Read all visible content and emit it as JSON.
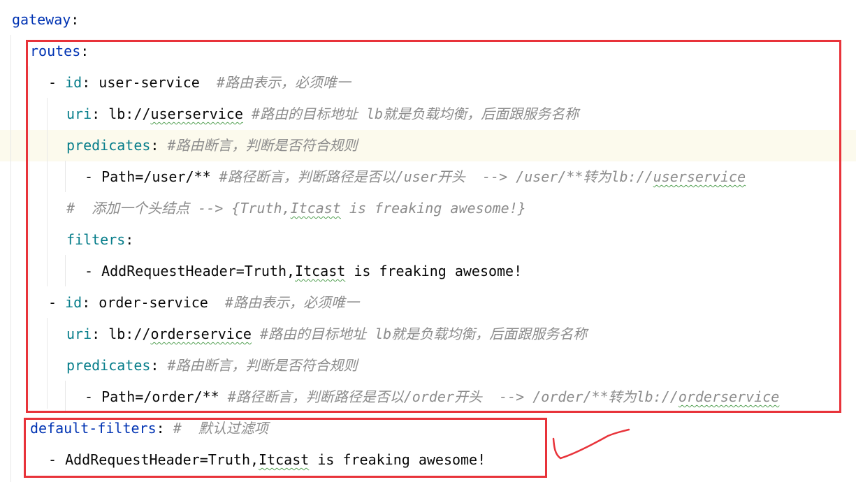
{
  "editor": {
    "lines": [
      {
        "parts": [
          {
            "t": "gateway",
            "c": "key"
          },
          {
            "t": ":",
            "c": "punc"
          }
        ]
      },
      {
        "parts": [
          {
            "t": "routes",
            "c": "key"
          },
          {
            "t": ":",
            "c": "punc"
          }
        ]
      },
      {
        "parts": [
          {
            "t": "- ",
            "c": "punc"
          },
          {
            "t": "id",
            "c": "key2"
          },
          {
            "t": ": ",
            "c": "punc"
          },
          {
            "t": "user-service  ",
            "c": "val"
          },
          {
            "t": "#路由表示，必须唯一",
            "c": "comment"
          }
        ]
      },
      {
        "parts": [
          {
            "t": "uri",
            "c": "key2"
          },
          {
            "t": ": ",
            "c": "punc"
          },
          {
            "t": "lb://",
            "c": "val"
          },
          {
            "t": "userservice",
            "c": "val typo"
          },
          {
            "t": " ",
            "c": "val"
          },
          {
            "t": "#路由的目标地址 lb就是负载均衡，后面跟服务名称",
            "c": "comment"
          }
        ]
      },
      {
        "parts": [
          {
            "t": "predicates",
            "c": "key2"
          },
          {
            "t": ": ",
            "c": "punc"
          },
          {
            "t": "#路由断言，判断是否符合规则",
            "c": "comment"
          }
        ]
      },
      {
        "parts": [
          {
            "t": "- Path=/user/** ",
            "c": "val"
          },
          {
            "t": "#路径断言，判断路径是否以/user开头  --> /user/**转为lb://",
            "c": "comment"
          },
          {
            "t": "userservice",
            "c": "comment typo"
          }
        ]
      },
      {
        "parts": [
          {
            "t": "#  添加一个头结点 --> {Truth,",
            "c": "comment"
          },
          {
            "t": "Itcast",
            "c": "comment typo"
          },
          {
            "t": " is freaking awesome!}",
            "c": "comment"
          }
        ]
      },
      {
        "parts": [
          {
            "t": "filters",
            "c": "key2"
          },
          {
            "t": ":",
            "c": "punc"
          }
        ]
      },
      {
        "parts": [
          {
            "t": "- AddRequestHeader=Truth,",
            "c": "val"
          },
          {
            "t": "Itcast",
            "c": "val typo"
          },
          {
            "t": " is freaking awesome!",
            "c": "val"
          }
        ]
      },
      {
        "parts": [
          {
            "t": "- ",
            "c": "punc"
          },
          {
            "t": "id",
            "c": "key2"
          },
          {
            "t": ": ",
            "c": "punc"
          },
          {
            "t": "order-service  ",
            "c": "val"
          },
          {
            "t": "#路由表示，必须唯一",
            "c": "comment"
          }
        ]
      },
      {
        "parts": [
          {
            "t": "uri",
            "c": "key2"
          },
          {
            "t": ": ",
            "c": "punc"
          },
          {
            "t": "lb://",
            "c": "val"
          },
          {
            "t": "orderservice",
            "c": "val typo"
          },
          {
            "t": " ",
            "c": "val"
          },
          {
            "t": "#路由的目标地址 lb就是负载均衡，后面跟服务名称",
            "c": "comment"
          }
        ]
      },
      {
        "parts": [
          {
            "t": "predicates",
            "c": "key2"
          },
          {
            "t": ": ",
            "c": "punc"
          },
          {
            "t": "#路由断言，判断是否符合规则",
            "c": "comment"
          }
        ]
      },
      {
        "parts": [
          {
            "t": "- Path=/order/** ",
            "c": "val"
          },
          {
            "t": "#路径断言，判断路径是否以/order开头  --> /order/**转为lb://",
            "c": "comment"
          },
          {
            "t": "orderservice",
            "c": "comment typo"
          }
        ]
      },
      {
        "parts": [
          {
            "t": "default-filters",
            "c": "key"
          },
          {
            "t": ": ",
            "c": "punc"
          },
          {
            "t": "#  默认过滤项",
            "c": "comment"
          }
        ]
      },
      {
        "parts": [
          {
            "t": "- AddRequestHeader=Truth,",
            "c": "val"
          },
          {
            "t": "Itcast",
            "c": "val typo"
          },
          {
            "t": " is freaking awesome!",
            "c": "val"
          }
        ]
      }
    ]
  },
  "colors": {
    "highlight_box": "#e8333a",
    "checkmark": "#e8333a",
    "key": "#0033b3",
    "nested_key": "#067d8a",
    "comment": "#8c8c8c",
    "current_line_bg": "#fcfaed"
  },
  "annotations": {
    "checkmark_icon": "hand-drawn-checkmark"
  }
}
